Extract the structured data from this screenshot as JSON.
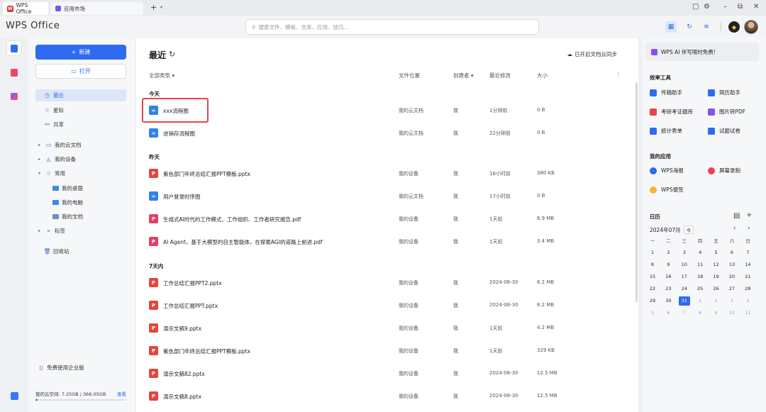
{
  "tabs": [
    {
      "label": "WPS Office",
      "logo": "W"
    },
    {
      "label": "应用市场"
    }
  ],
  "header": {
    "brand": "WPS Office",
    "search_placeholder": "搜索文件、模板、文库、应用、技巧..."
  },
  "sidebar": {
    "new_label": "新建",
    "open_label": "打开",
    "items": [
      {
        "label": "最近"
      },
      {
        "label": "星标"
      },
      {
        "label": "共享"
      },
      {
        "label": "我的云文档"
      },
      {
        "label": "我的设备"
      },
      {
        "label": "常用"
      },
      {
        "label": "我的桌面"
      },
      {
        "label": "我的电脑"
      },
      {
        "label": "我的文档"
      },
      {
        "label": "标签"
      },
      {
        "label": "回收站"
      }
    ],
    "enterprise_label": "免费使用企业版",
    "storage_text": "我的云空间: 7.25GB / 366.05GB",
    "storage_view": "查看",
    "storage_fraction": 0.02
  },
  "main": {
    "title": "最近",
    "sync_label": "已开启文档云同步",
    "columns": {
      "type": "全部类型",
      "location": "文件位置",
      "creator": "创建者",
      "modified": "最近修改",
      "size": "大小"
    },
    "groups": [
      {
        "label": "今天"
      },
      {
        "label": "昨天"
      },
      {
        "label": "7天内"
      }
    ],
    "files": [
      {
        "name": "xxx流程图",
        "kind": "flow",
        "location": "我的云文档",
        "creator": "我",
        "modified": "1分钟前",
        "size": "0 B"
      },
      {
        "name": "进销存流程图",
        "kind": "flow",
        "location": "我的云文档",
        "creator": "我",
        "modified": "22分钟前",
        "size": "0 B"
      },
      {
        "name": "紫色部门年终总结汇报PPT模板.pptx",
        "kind": "ppt",
        "location": "我的设备",
        "creator": "我",
        "modified": "16小时前",
        "size": "380 KB"
      },
      {
        "name": "用户登录时序图",
        "kind": "flow",
        "location": "我的云文档",
        "creator": "我",
        "modified": "17小时前",
        "size": "0 B"
      },
      {
        "name": "生成式AI时代的工作模式、工作组织、工作者研究报告.pdf",
        "kind": "pdf",
        "location": "我的设备",
        "creator": "我",
        "modified": "1天前",
        "size": "6.9 MB"
      },
      {
        "name": "AI Agent，基于大模型的自主智能体，在探索AGI的道路上前进.pdf",
        "kind": "pdf",
        "location": "我的设备",
        "creator": "我",
        "modified": "1天前",
        "size": "3.4 MB"
      },
      {
        "name": "工作总结汇报PPT2.pptx",
        "kind": "ppt",
        "location": "我的设备",
        "creator": "我",
        "modified": "2024-06-30",
        "size": "6.2 MB"
      },
      {
        "name": "工作总结汇报PPT.pptx",
        "kind": "ppt",
        "location": "我的设备",
        "creator": "我",
        "modified": "2024-06-30",
        "size": "6.2 MB"
      },
      {
        "name": "演示文稿9.pptx",
        "kind": "ppt",
        "location": "我的设备",
        "creator": "我",
        "modified": "1天前",
        "size": "4.2 MB"
      },
      {
        "name": "紫色部门年终总结汇报PPT模板.pptx",
        "kind": "ppt",
        "location": "我的设备",
        "creator": "我",
        "modified": "1天前",
        "size": "329 KB"
      },
      {
        "name": "演示文稿82.pptx",
        "kind": "ppt",
        "location": "我的设备",
        "creator": "我",
        "modified": "2024-06-30",
        "size": "12.5 MB"
      },
      {
        "name": "演示文稿8.pptx",
        "kind": "ppt",
        "location": "我的设备",
        "creator": "我",
        "modified": "2024-06-30",
        "size": "12.5 MB"
      }
    ]
  },
  "right": {
    "ai_banner": "WPS AI 伴写限时免费!",
    "tools_title": "效率工具",
    "tools": [
      {
        "label": "传输助手",
        "color": "#2f6bf0"
      },
      {
        "label": "简历助手",
        "color": "#2f6bf0"
      },
      {
        "label": "考研考证题库",
        "color": "#e8444c"
      },
      {
        "label": "图片转PDF",
        "color": "#8a4ff0"
      },
      {
        "label": "统计表单",
        "color": "#2f6bf0"
      },
      {
        "label": "试题试卷",
        "color": "#2f6bf0"
      }
    ],
    "apps_title": "我的应用",
    "apps": [
      {
        "label": "WPS海报",
        "color": "#2f6bf0"
      },
      {
        "label": "屏幕录制",
        "color": "#e8444c"
      },
      {
        "label": "WPS便签",
        "color": "#f2b630"
      }
    ],
    "calendar": {
      "title": "日历",
      "month": "2024年07月",
      "today_label": "今",
      "weekdays": [
        "一",
        "二",
        "三",
        "四",
        "五",
        "六",
        "日"
      ],
      "weeks": [
        [
          "1",
          "2",
          "3",
          "4",
          "5",
          "6",
          "7"
        ],
        [
          "8",
          "9",
          "10",
          "11",
          "12",
          "13",
          "14"
        ],
        [
          "15",
          "16",
          "17",
          "18",
          "19",
          "20",
          "21"
        ],
        [
          "22",
          "23",
          "24",
          "25",
          "26",
          "27",
          "28"
        ],
        [
          "29",
          "30",
          "31",
          "1",
          "2",
          "3",
          "4"
        ],
        [
          "5",
          "6",
          "7",
          "8",
          "9",
          "10",
          "11"
        ]
      ],
      "selected": "31"
    }
  }
}
